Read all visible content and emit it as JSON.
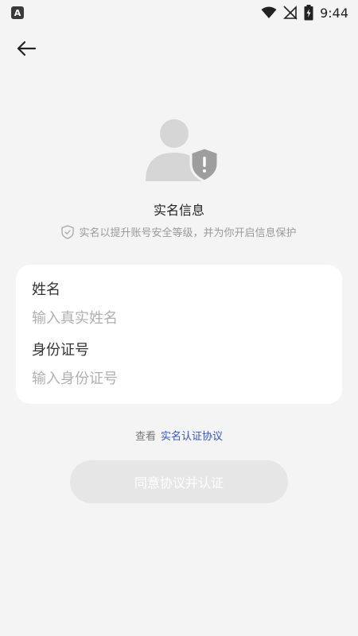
{
  "status_bar": {
    "app_badge": "A",
    "time": "9:44"
  },
  "header": {
    "back_icon": "arrow-left-icon"
  },
  "illustration": {
    "icon": "user-shield-alert-icon"
  },
  "info": {
    "title": "实名信息",
    "description": "实名以提升账号安全等级，并为你开启信息保护"
  },
  "form": {
    "name": {
      "label": "姓名",
      "placeholder": "输入真实姓名",
      "value": ""
    },
    "id_number": {
      "label": "身份证号",
      "placeholder": "输入身份证号",
      "value": ""
    }
  },
  "agreement": {
    "prefix": "查看",
    "link": "实名认证协议"
  },
  "submit": {
    "label": "同意协议并认证",
    "enabled": false
  },
  "colors": {
    "background": "#f4f4f4",
    "card": "#ffffff",
    "link": "#3553c7",
    "button_disabled": "#e6e6e6"
  }
}
